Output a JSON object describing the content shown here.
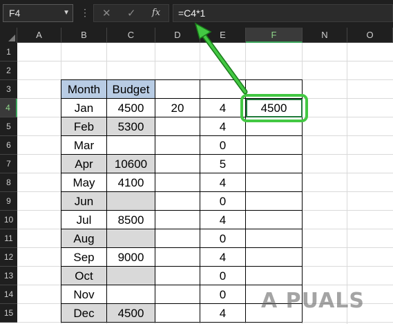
{
  "formula_bar": {
    "name_box": "F4",
    "cancel_icon": "✕",
    "enter_icon": "✓",
    "fx_label": "fx",
    "formula": "=C4*1"
  },
  "columns": [
    "A",
    "B",
    "C",
    "D",
    "E",
    "F",
    "N",
    "O"
  ],
  "selected_column": "F",
  "rows": [
    "1",
    "2",
    "3",
    "4",
    "5",
    "6",
    "7",
    "8",
    "9",
    "10",
    "11",
    "12",
    "13",
    "14",
    "15"
  ],
  "selected_row": "4",
  "headers": {
    "month": "Month",
    "budget": "Budget"
  },
  "table": [
    {
      "month": "Jan",
      "budget": "4500",
      "d": "20",
      "e": "4",
      "f": "4500"
    },
    {
      "month": "Feb",
      "budget": "5300",
      "d": "",
      "e": "4",
      "f": ""
    },
    {
      "month": "Mar",
      "budget": "",
      "d": "",
      "e": "0",
      "f": ""
    },
    {
      "month": "Apr",
      "budget": "10600",
      "d": "",
      "e": "5",
      "f": ""
    },
    {
      "month": "May",
      "budget": "4100",
      "d": "",
      "e": "4",
      "f": ""
    },
    {
      "month": "Jun",
      "budget": "",
      "d": "",
      "e": "0",
      "f": ""
    },
    {
      "month": "Jul",
      "budget": "8500",
      "d": "",
      "e": "4",
      "f": ""
    },
    {
      "month": "Aug",
      "budget": "",
      "d": "",
      "e": "0",
      "f": ""
    },
    {
      "month": "Sep",
      "budget": "9000",
      "d": "",
      "e": "4",
      "f": ""
    },
    {
      "month": "Oct",
      "budget": "",
      "d": "",
      "e": "0",
      "f": ""
    },
    {
      "month": "Nov",
      "budget": "",
      "d": "",
      "e": "0",
      "f": ""
    },
    {
      "month": "Dec",
      "budget": "4500",
      "d": "",
      "e": "4",
      "f": ""
    }
  ],
  "watermark": "A PUALS",
  "colors": {
    "accent_green": "#43c843",
    "header_fill": "#b8cce4",
    "shade_fill": "#d9d9d9"
  }
}
